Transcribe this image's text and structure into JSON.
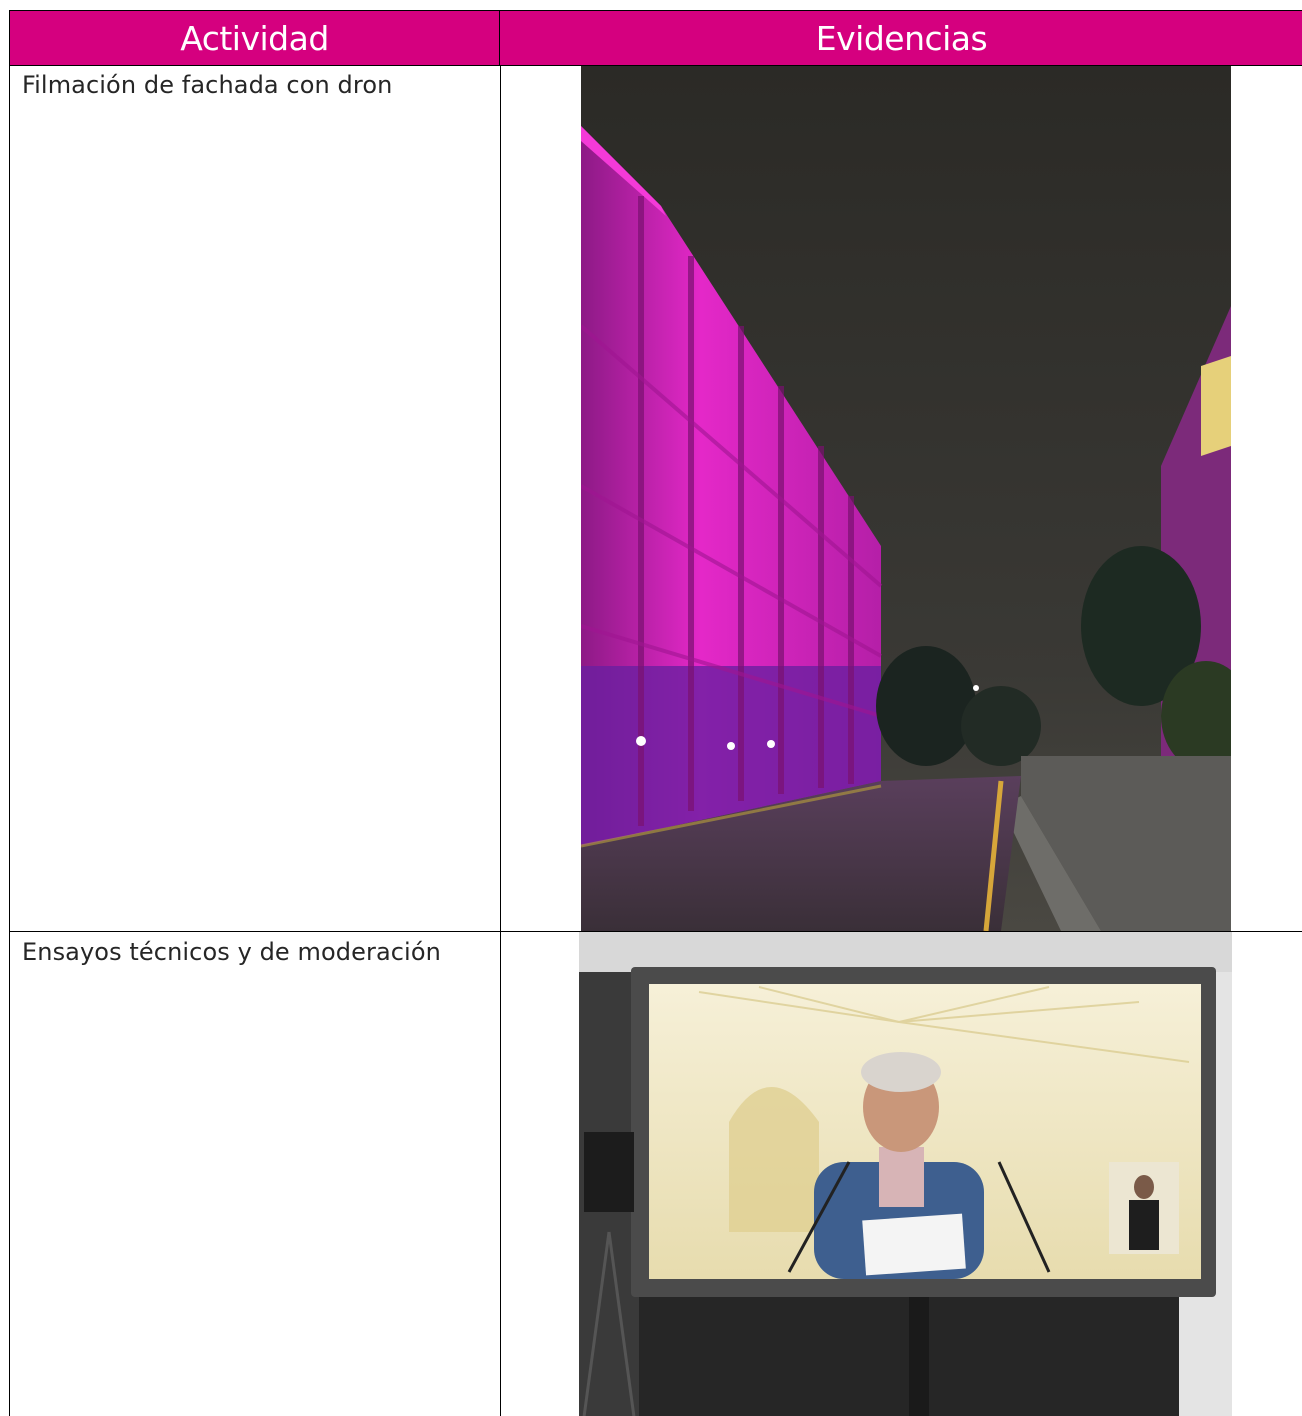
{
  "table": {
    "headers": [
      "Actividad",
      "Evidencias"
    ],
    "rows": [
      {
        "actividad": "Filmación de fachada con dron",
        "evidencia": "photo-building-facade-magenta-night"
      },
      {
        "actividad": "Ensayos técnicos y de moderación",
        "evidencia": "photo-monitor-rehearsal-speaker"
      }
    ]
  },
  "colors": {
    "header_bg": "#d5007f",
    "header_text": "#ffffff",
    "body_text": "#262626",
    "border": "#000000"
  }
}
